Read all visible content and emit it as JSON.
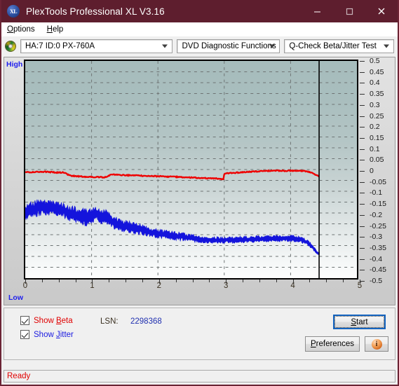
{
  "window": {
    "title": "PlexTools Professional XL V3.16",
    "icon": "xl-logo-icon",
    "controls": {
      "minimize": "minimize-icon",
      "maximize": "maximize-icon",
      "close": "close-icon"
    }
  },
  "menu": {
    "items": [
      {
        "label": "Options",
        "accel": "O"
      },
      {
        "label": "Help",
        "accel": "H"
      }
    ]
  },
  "toolbar": {
    "disc_icon": "disc-icon",
    "drive": {
      "value": "HA:7 ID:0  PX-760A"
    },
    "function": {
      "value": "DVD Diagnostic Functions"
    },
    "test": {
      "value": "Q-Check Beta/Jitter Test"
    }
  },
  "chart_data": {
    "type": "line",
    "title": "",
    "xlabel": "",
    "ylabel": "",
    "xlim": [
      0,
      5
    ],
    "ylim": [
      -0.5,
      0.5
    ],
    "grid": true,
    "x_ticks": [
      "0",
      "1",
      "2",
      "3",
      "4",
      "5"
    ],
    "x_tick_values": [
      0,
      1,
      2,
      3,
      4,
      5
    ],
    "y_ticks": [
      "0.5",
      "0.45",
      "0.4",
      "0.35",
      "0.3",
      "0.25",
      "0.2",
      "0.15",
      "0.1",
      "0.05",
      "0",
      "-0.05",
      "-0.1",
      "-0.15",
      "-0.2",
      "-0.25",
      "-0.3",
      "-0.35",
      "-0.4",
      "-0.45",
      "-0.5"
    ],
    "y_tick_values": [
      0.5,
      0.45,
      0.4,
      0.35,
      0.3,
      0.25,
      0.2,
      0.15,
      0.1,
      0.05,
      0,
      -0.05,
      -0.1,
      -0.15,
      -0.2,
      -0.25,
      -0.3,
      -0.35,
      -0.4,
      -0.45,
      -0.5
    ],
    "axis_left_label": "High",
    "axis_left_label_bottom": "Low",
    "cursor_x": 4.43,
    "data_end_x": 4.43,
    "series": [
      {
        "name": "Beta",
        "color": "#ee0000",
        "x": [
          0.0,
          0.1,
          0.2,
          0.3,
          0.4,
          0.5,
          0.58,
          0.62,
          0.66,
          0.7,
          0.74,
          0.78,
          0.82,
          0.86,
          0.9,
          1.0,
          1.1,
          1.2,
          1.3,
          1.4,
          1.5,
          1.6,
          1.7,
          1.8,
          1.9,
          2.0,
          2.1,
          2.2,
          2.3,
          2.4,
          2.5,
          2.6,
          2.7,
          2.8,
          2.9,
          2.96,
          2.99,
          3.0,
          3.05,
          3.15,
          3.3,
          3.45,
          3.6,
          3.75,
          3.9,
          4.05,
          4.15,
          4.25,
          4.32,
          4.38,
          4.43
        ],
        "y": [
          -0.012,
          -0.012,
          -0.011,
          -0.01,
          -0.012,
          -0.014,
          -0.013,
          -0.02,
          -0.026,
          -0.029,
          -0.03,
          -0.031,
          -0.031,
          -0.032,
          -0.033,
          -0.034,
          -0.035,
          -0.036,
          -0.023,
          -0.024,
          -0.026,
          -0.027,
          -0.028,
          -0.029,
          -0.03,
          -0.031,
          -0.032,
          -0.033,
          -0.034,
          -0.036,
          -0.037,
          -0.038,
          -0.04,
          -0.041,
          -0.042,
          -0.043,
          -0.044,
          -0.019,
          -0.018,
          -0.015,
          -0.012,
          -0.009,
          -0.007,
          -0.005,
          -0.006,
          -0.006,
          -0.006,
          -0.008,
          -0.014,
          -0.024,
          -0.032
        ]
      },
      {
        "name": "Jitter",
        "color": "#1414dc",
        "band": true,
        "x": [
          0.0,
          0.08,
          0.16,
          0.24,
          0.32,
          0.4,
          0.48,
          0.56,
          0.64,
          0.72,
          0.8,
          0.88,
          0.96,
          1.04,
          1.08,
          1.12,
          1.16,
          1.2,
          1.24,
          1.28,
          1.34,
          1.4,
          1.48,
          1.56,
          1.64,
          1.72,
          1.8,
          1.88,
          1.96,
          2.04,
          2.12,
          2.2,
          2.28,
          2.36,
          2.44,
          2.52,
          2.6,
          2.68,
          2.76,
          2.84,
          2.92,
          3.0,
          3.1,
          3.2,
          3.3,
          3.4,
          3.5,
          3.6,
          3.7,
          3.8,
          3.9,
          4.0,
          4.08,
          4.14,
          4.2,
          4.26,
          4.3,
          4.34,
          4.37,
          4.4,
          4.43
        ],
        "y_center": [
          -0.196,
          -0.185,
          -0.178,
          -0.174,
          -0.174,
          -0.176,
          -0.181,
          -0.188,
          -0.196,
          -0.204,
          -0.212,
          -0.219,
          -0.222,
          -0.208,
          -0.2,
          -0.212,
          -0.224,
          -0.216,
          -0.222,
          -0.233,
          -0.244,
          -0.252,
          -0.258,
          -0.264,
          -0.27,
          -0.275,
          -0.281,
          -0.287,
          -0.292,
          -0.296,
          -0.3,
          -0.303,
          -0.306,
          -0.309,
          -0.313,
          -0.317,
          -0.32,
          -0.322,
          -0.323,
          -0.324,
          -0.325,
          -0.325,
          -0.324,
          -0.323,
          -0.322,
          -0.321,
          -0.32,
          -0.319,
          -0.318,
          -0.317,
          -0.317,
          -0.317,
          -0.319,
          -0.322,
          -0.328,
          -0.338,
          -0.348,
          -0.36,
          -0.372,
          -0.382,
          -0.388
        ],
        "y_halfwidth": [
          0.024,
          0.026,
          0.026,
          0.024,
          0.024,
          0.023,
          0.023,
          0.024,
          0.024,
          0.025,
          0.025,
          0.026,
          0.028,
          0.022,
          0.018,
          0.022,
          0.026,
          0.022,
          0.022,
          0.02,
          0.02,
          0.019,
          0.018,
          0.018,
          0.017,
          0.017,
          0.016,
          0.016,
          0.015,
          0.015,
          0.014,
          0.014,
          0.013,
          0.013,
          0.012,
          0.012,
          0.011,
          0.011,
          0.011,
          0.01,
          0.01,
          0.01,
          0.01,
          0.01,
          0.01,
          0.01,
          0.01,
          0.01,
          0.01,
          0.01,
          0.01,
          0.01,
          0.01,
          0.009,
          0.009,
          0.008,
          0.008,
          0.007,
          0.006,
          0.005,
          0.004
        ]
      }
    ]
  },
  "controls": {
    "show_beta": {
      "label_pre": "Show ",
      "label_accel": "B",
      "label_post": "eta",
      "checked": true,
      "color": "#e00000"
    },
    "show_jitter": {
      "label_pre": "Show ",
      "label_accel": "J",
      "label_post": "itter",
      "checked": true,
      "color": "#1a1ae0"
    },
    "lsn_label": "LSN:",
    "lsn_value": "2298368",
    "start_button": {
      "label_pre": "",
      "label_accel": "S",
      "label_post": "tart"
    },
    "preferences_button": {
      "label_pre": "",
      "label_accel": "P",
      "label_post": "references"
    },
    "info_button": {
      "icon": "info-icon",
      "glyph": "i"
    }
  },
  "statusbar": {
    "text": "Ready"
  }
}
